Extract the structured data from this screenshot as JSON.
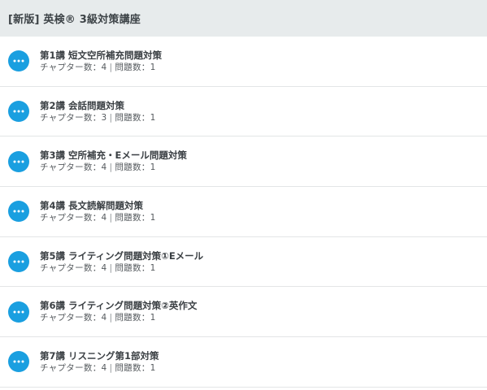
{
  "course": {
    "title": "[新版] 英検® 3級対策講座"
  },
  "colors": {
    "header_bg": "#e7ebec",
    "icon_bg": "#1a9fe0"
  },
  "icons": {
    "lecture_icon": "more-icon"
  },
  "lectures": [
    {
      "title": "第1講 短文空所補充問題対策",
      "chapters_label": "チャプター数",
      "chapters": "4",
      "questions_label": "問題数",
      "questions": "1"
    },
    {
      "title": "第2講 会話問題対策",
      "chapters_label": "チャプター数",
      "chapters": "3",
      "questions_label": "問題数",
      "questions": "1"
    },
    {
      "title": "第3講 空所補充・Eメール問題対策",
      "chapters_label": "チャプター数",
      "chapters": "4",
      "questions_label": "問題数",
      "questions": "1"
    },
    {
      "title": "第4講 長文読解問題対策",
      "chapters_label": "チャプター数",
      "chapters": "4",
      "questions_label": "問題数",
      "questions": "1"
    },
    {
      "title": "第5講 ライティング問題対策①Eメール",
      "chapters_label": "チャプター数",
      "chapters": "4",
      "questions_label": "問題数",
      "questions": "1"
    },
    {
      "title": "第6講 ライティング問題対策②英作文",
      "chapters_label": "チャプター数",
      "chapters": "4",
      "questions_label": "問題数",
      "questions": "1"
    },
    {
      "title": "第7講 リスニング第1部対策",
      "chapters_label": "チャプター数",
      "chapters": "4",
      "questions_label": "問題数",
      "questions": "1"
    }
  ]
}
